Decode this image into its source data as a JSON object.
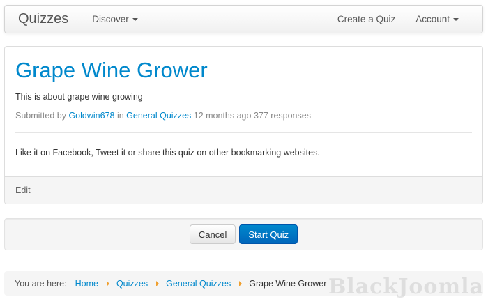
{
  "navbar": {
    "brand": "Quizzes",
    "discover": "Discover",
    "create_quiz": "Create a Quiz",
    "account": "Account"
  },
  "quiz": {
    "title": "Grape Wine Grower",
    "description": "This is about grape wine growing",
    "submitted_by_prefix": "Submitted by",
    "author": "Goldwin678",
    "in_text": "in",
    "category": "General Quizzes",
    "time_ago": "12 months ago",
    "responses": "377 responses",
    "share_text": "Like it on Facebook, Tweet it or share this quiz on other bookmarking websites.",
    "edit_label": "Edit"
  },
  "actions": {
    "cancel_label": "Cancel",
    "start_label": "Start Quiz"
  },
  "breadcrumb": {
    "label": "You are here:",
    "items": [
      "Home",
      "Quizzes",
      "General Quizzes"
    ],
    "current": "Grape Wine Grower"
  },
  "watermark": "BlackJoomla",
  "colors": {
    "link": "#0088cc",
    "primary_button": "#0077cc",
    "breadcrumb_separator": "#f0a030"
  }
}
